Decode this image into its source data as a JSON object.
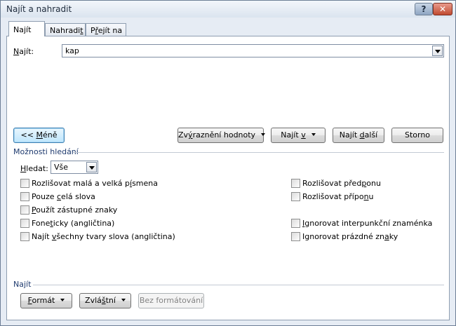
{
  "window": {
    "title": "Najít a nahradit",
    "help_label": "?",
    "close_label": "✕"
  },
  "tabs": {
    "find": {
      "pre": "Na",
      "key": "j",
      "post": "ít"
    },
    "replace": {
      "pre": "Nahradi",
      "key": "t",
      "post": ""
    },
    "goto": {
      "pre": "P",
      "key": "ř",
      "post": "ejít na"
    }
  },
  "find_field": {
    "label_pre": "",
    "label_key": "N",
    "label_post": "ajít:",
    "value": "kap"
  },
  "buttons": {
    "less": {
      "pre": "<< ",
      "key": "M",
      "post": "éně"
    },
    "highlight": {
      "pre": "Zv",
      "key": "ý",
      "post": "raznění hodnoty"
    },
    "find_in": {
      "pre": "Najít ",
      "key": "v",
      "post": ""
    },
    "find_next": {
      "pre": "Najít ",
      "key": "d",
      "post": "alší"
    },
    "cancel": "Storno",
    "format": {
      "pre": "",
      "key": "F",
      "post": "ormát"
    },
    "special": {
      "pre": "Zvlá",
      "key": "š",
      "post": "tní"
    },
    "no_format": "Bez formátování"
  },
  "options": {
    "section_label": "Možnosti hledání",
    "search_label": {
      "pre": "",
      "key": "H",
      "post": "ledat:"
    },
    "search_value": "Vše",
    "left": [
      {
        "pre": "Rozlišovat malá a velká p",
        "key": "í",
        "post": "smena"
      },
      {
        "pre": "Pouze ",
        "key": "c",
        "post": "elá slova"
      },
      {
        "pre": "",
        "key": "P",
        "post": "oužít zástupné znaky"
      },
      {
        "pre": "Fone",
        "key": "t",
        "post": "icky (angličtina)"
      },
      {
        "pre": "Najít ",
        "key": "v",
        "post": "šechny tvary slova (angličtina)"
      }
    ],
    "right": [
      {
        "pre": "Rozlišovat před",
        "key": "p",
        "post": "onu"
      },
      {
        "pre": "Rozlišovat přípo",
        "key": "n",
        "post": "u"
      },
      {
        "pre": "",
        "key": "I",
        "post": "gnorovat interpunkční znaménka"
      },
      {
        "pre": "Ignorovat prázdné zn",
        "key": "a",
        "post": "ky"
      }
    ]
  },
  "find_section_label": "Najít"
}
